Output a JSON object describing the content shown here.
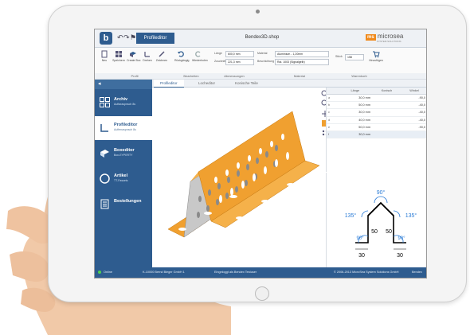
{
  "window": {
    "title": "Bendex3D.shop",
    "tab": "Profileditor"
  },
  "brand": {
    "mark": "ms",
    "name": "microsea",
    "sub": "SYSTEM SOLUTIONS"
  },
  "ribbon": {
    "buttons": [
      {
        "label": "Neu"
      },
      {
        "label": "Speichern"
      },
      {
        "label": "Create Box"
      },
      {
        "label": "Drehen"
      },
      {
        "label": "Zeichnen"
      },
      {
        "label": "Rückgängig"
      },
      {
        "label": "Wiederholen"
      }
    ],
    "fields": {
      "laenge_label": "Länge",
      "laenge_value": "600,0 mm",
      "zuschnitt_label": "Zuschnitt",
      "zuschnitt_value": "221,3 mm",
      "material_label": "Material",
      "material_value": "Aluminium - 1,20mm",
      "beschichtung_label": "Beschichtung",
      "beschichtung_value": "Ral. 1003 (Signalgelb)",
      "stueck_label": "Stück",
      "stueck_value": "158",
      "cart_label": "Hinzufügen"
    },
    "groups": [
      "Profil",
      "Bearbeiten",
      "Abmessungen",
      "Material",
      "Warenkorb"
    ]
  },
  "sidebar": {
    "header_arrow": "◂",
    "items": [
      {
        "title": "Archiv",
        "sub": "Auftaraspnsch 8s"
      },
      {
        "title": "Profileditor",
        "sub": "Auftenaspnsch 8s"
      },
      {
        "title": "Boxeditor",
        "sub": "Box-EYPERTY"
      },
      {
        "title": "Artikel",
        "sub": "TT-Fassets"
      },
      {
        "title": "Bestellungen",
        "sub": ""
      }
    ]
  },
  "content_tabs": [
    "Profileditor",
    "Locheditor",
    "Konische Teile"
  ],
  "table": {
    "headers": [
      "",
      "Länge",
      "Konisch",
      "Winkel"
    ],
    "rows": [
      [
        "a",
        "30,0 mm",
        "",
        "-90,0"
      ],
      [
        "b",
        "50,0 mm",
        "",
        "-40,0"
      ],
      [
        "c",
        "30,0 mm",
        "",
        "-40,0"
      ],
      [
        "d",
        "40,0 mm",
        "",
        "-40,0"
      ],
      [
        "e",
        "50,0 mm",
        "",
        "-90,0"
      ],
      [
        "f",
        "30,0 mm",
        "",
        ""
      ]
    ]
  },
  "diagram": {
    "angles": {
      "top": "90°",
      "left": "135°",
      "right": "135°",
      "bottom_left": "90°",
      "bottom_right": "90°"
    },
    "lengths": {
      "left_side": "50",
      "right_side": "50",
      "bottom_left": "30",
      "bottom_right": "30"
    }
  },
  "status": {
    "online": "Online",
    "company": "K-10000 Bernd Bieger GmbH 1",
    "login": "Eingeloggt als Bendex Testuser",
    "copyright": "© 2006-2013 MicroSea System Solutions GmbH",
    "app": "Bendex"
  },
  "colors": {
    "accent": "#2e5c8f",
    "profile": "#f0a030",
    "perforated": "#c8c8c8"
  }
}
